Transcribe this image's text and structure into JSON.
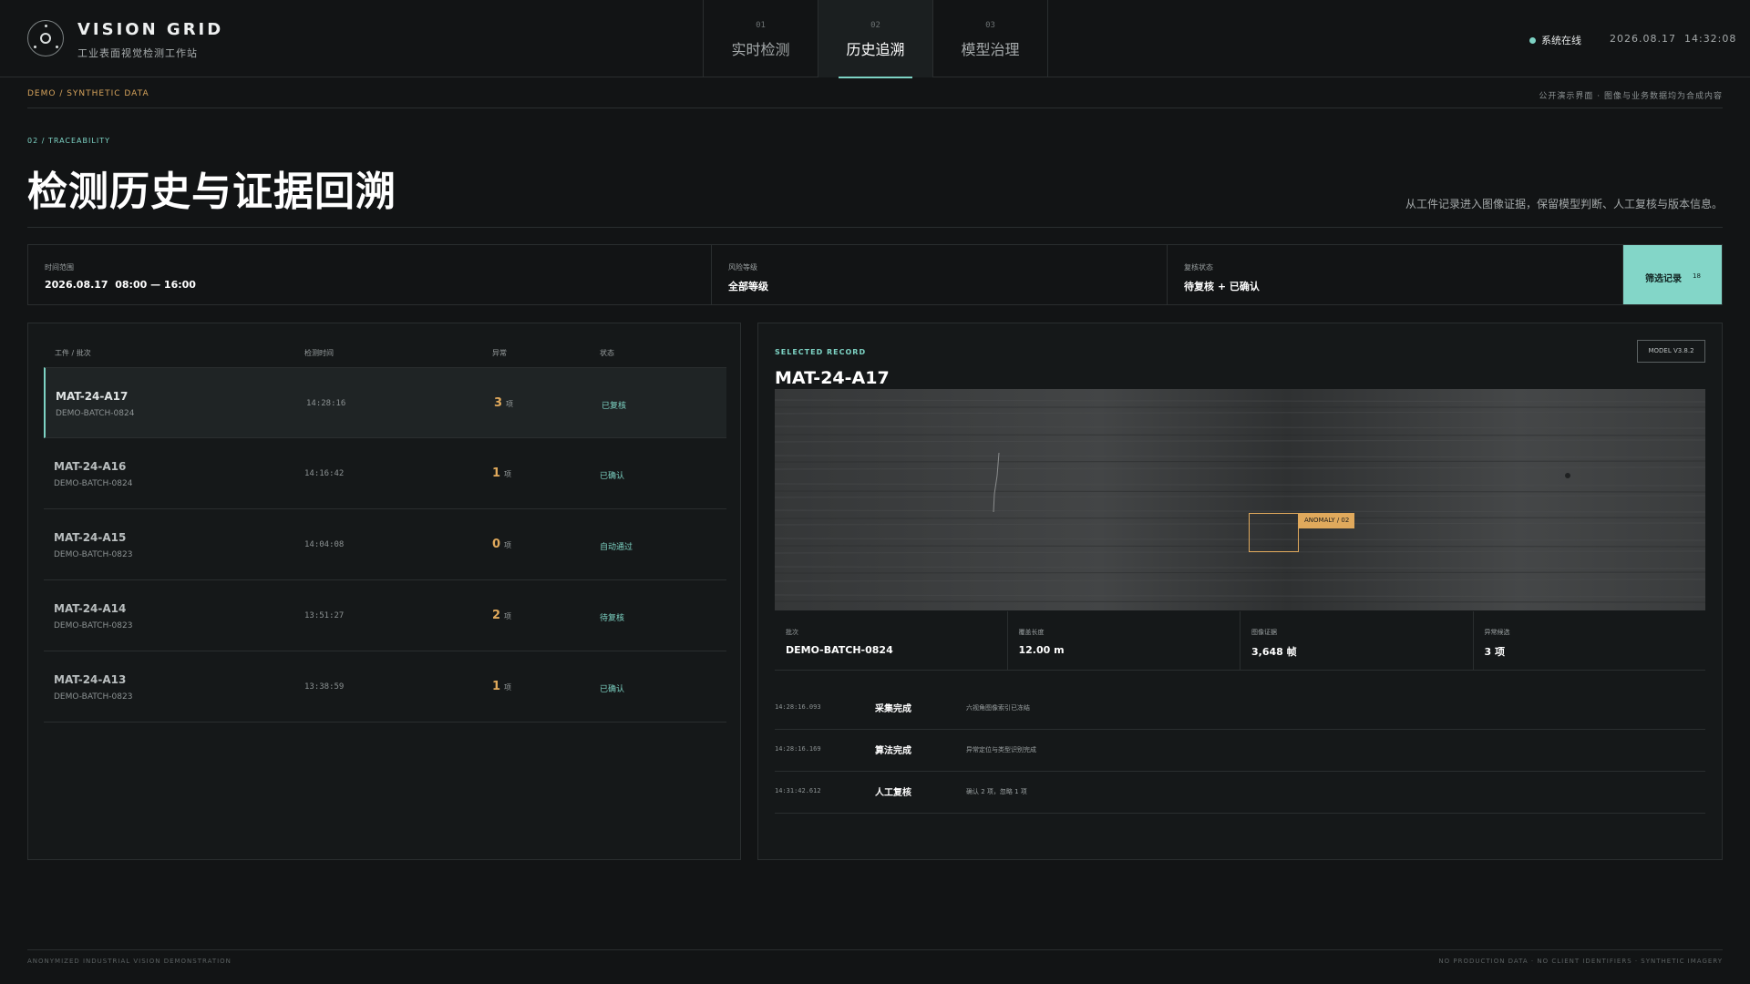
{
  "brand": {
    "title": "VISION GRID",
    "subtitle": "工业表面视觉检测工作站"
  },
  "tabs": [
    {
      "num": "01",
      "label": "实时检测",
      "active": false
    },
    {
      "num": "02",
      "label": "历史追溯",
      "active": true
    },
    {
      "num": "03",
      "label": "模型治理",
      "active": false
    }
  ],
  "status": {
    "label": "系统在线",
    "date": "2026.08.17",
    "time": "14:32:08"
  },
  "demo": {
    "left": "DEMO / SYNTHETIC DATA",
    "right": "公开演示界面 · 图像与业务数据均为合成内容"
  },
  "page": {
    "section": "02 / TRACEABILITY",
    "title": "检测历史与证据回溯",
    "description": "从工件记录进入图像证据，保留模型判断、人工复核与版本信息。"
  },
  "filters": [
    {
      "label": "时间范围",
      "value": "2026.08.17  08:00 — 16:00"
    },
    {
      "label": "风险等级",
      "value": "全部等级"
    },
    {
      "label": "复核状态",
      "value": "待复核 + 已确认"
    }
  ],
  "filter_button": {
    "label": "筛选记录",
    "count": "18"
  },
  "records": {
    "columns": {
      "part": "工件 / 批次",
      "time": "检测时间",
      "anomaly": "异常",
      "status": "状态"
    },
    "unit": "项",
    "rows": [
      {
        "id": "MAT-24-A17",
        "batch": "DEMO-BATCH-0824",
        "time": "14:28:16",
        "count": "3",
        "status": "已复核"
      },
      {
        "id": "MAT-24-A16",
        "batch": "DEMO-BATCH-0824",
        "time": "14:16:42",
        "count": "1",
        "status": "已确认"
      },
      {
        "id": "MAT-24-A15",
        "batch": "DEMO-BATCH-0823",
        "time": "14:04:08",
        "count": "0",
        "status": "自动通过"
      },
      {
        "id": "MAT-24-A14",
        "batch": "DEMO-BATCH-0823",
        "time": "13:51:27",
        "count": "2",
        "status": "待复核"
      },
      {
        "id": "MAT-24-A13",
        "batch": "DEMO-BATCH-0823",
        "time": "13:38:59",
        "count": "1",
        "status": "已确认"
      }
    ]
  },
  "detail": {
    "tag": "SELECTED RECORD",
    "id": "MAT-24-A17",
    "model": "MODEL V3.8.2",
    "anomaly_label": "ANOMALY / 02",
    "metrics": [
      {
        "label": "批次",
        "value": "DEMO-BATCH-0824"
      },
      {
        "label": "覆盖长度",
        "value": "12.00 m"
      },
      {
        "label": "图像证据",
        "value": "3,648 帧"
      },
      {
        "label": "异常候选",
        "value": "3 项"
      }
    ],
    "timeline": [
      {
        "time": "14:28:16.093",
        "event": "采集完成",
        "desc": "六视角图像索引已冻结"
      },
      {
        "time": "14:28:16.169",
        "event": "算法完成",
        "desc": "异常定位与类型识别完成"
      },
      {
        "time": "14:31:42.612",
        "event": "人工复核",
        "desc": "确认 2 项，忽略 1 项"
      }
    ]
  },
  "footer": {
    "left": "ANONYMIZED INDUSTRIAL VISION DEMONSTRATION",
    "right": "NO PRODUCTION DATA · NO CLIENT IDENTIFIERS · SYNTHETIC IMAGERY"
  },
  "colors": {
    "accent": "#7dd3c4",
    "warning": "#e0a95c",
    "background": "#121415"
  }
}
